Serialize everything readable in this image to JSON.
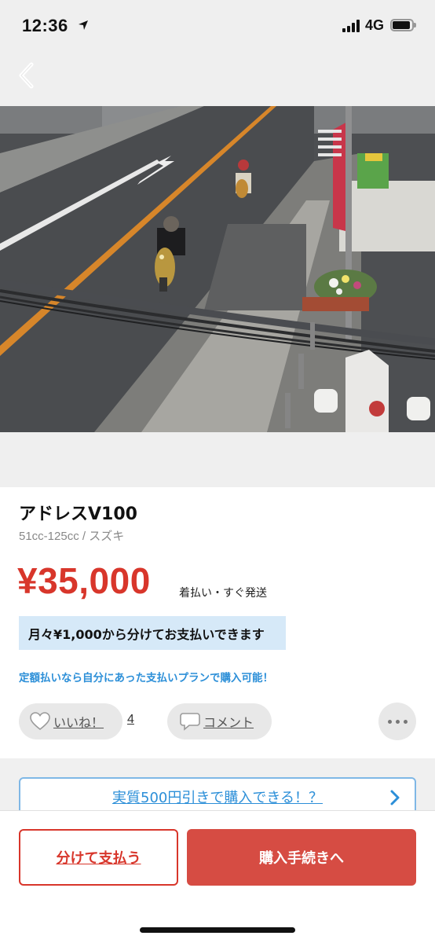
{
  "status_bar": {
    "time": "12:36",
    "network": "4G"
  },
  "nav": {
    "back_icon": "chevron-left-icon"
  },
  "product": {
    "photo_description_icon": "scooter-street-photo",
    "title": "アドレスV100",
    "category": "51cc-125cc / スズキ",
    "price": "¥35,000",
    "shipping": "着払い・すぐ発送",
    "installment_text": "月々¥1,000から分けてお支払いできます",
    "plan_note": "定額払いなら自分にあった支払いプランで購入可能！"
  },
  "social": {
    "like_label": "いいね！",
    "like_count": "4",
    "comment_label": "コメント",
    "more_icon": "more-horizontal-icon"
  },
  "promo": {
    "discount_label": "実質500円引きで購入できる！？"
  },
  "actions": {
    "split_pay_label": "分けて支払う",
    "purchase_label": "購入手続きへ"
  },
  "colors": {
    "price_red": "#d8362b",
    "purchase_button": "#d64c43",
    "link_blue": "#2c8fd8",
    "installment_bg": "#d6e9f8"
  }
}
